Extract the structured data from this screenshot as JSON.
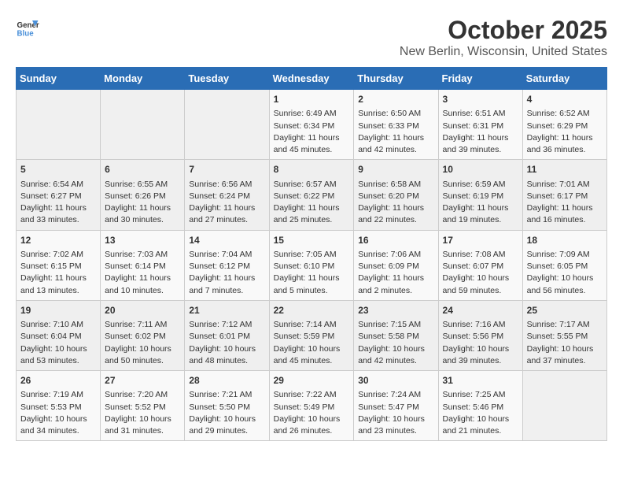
{
  "logo": {
    "line1": "General",
    "line2": "Blue"
  },
  "title": "October 2025",
  "location": "New Berlin, Wisconsin, United States",
  "days_of_week": [
    "Sunday",
    "Monday",
    "Tuesday",
    "Wednesday",
    "Thursday",
    "Friday",
    "Saturday"
  ],
  "weeks": [
    [
      {
        "day": "",
        "info": ""
      },
      {
        "day": "",
        "info": ""
      },
      {
        "day": "",
        "info": ""
      },
      {
        "day": "1",
        "info": "Sunrise: 6:49 AM\nSunset: 6:34 PM\nDaylight: 11 hours\nand 45 minutes."
      },
      {
        "day": "2",
        "info": "Sunrise: 6:50 AM\nSunset: 6:33 PM\nDaylight: 11 hours\nand 42 minutes."
      },
      {
        "day": "3",
        "info": "Sunrise: 6:51 AM\nSunset: 6:31 PM\nDaylight: 11 hours\nand 39 minutes."
      },
      {
        "day": "4",
        "info": "Sunrise: 6:52 AM\nSunset: 6:29 PM\nDaylight: 11 hours\nand 36 minutes."
      }
    ],
    [
      {
        "day": "5",
        "info": "Sunrise: 6:54 AM\nSunset: 6:27 PM\nDaylight: 11 hours\nand 33 minutes."
      },
      {
        "day": "6",
        "info": "Sunrise: 6:55 AM\nSunset: 6:26 PM\nDaylight: 11 hours\nand 30 minutes."
      },
      {
        "day": "7",
        "info": "Sunrise: 6:56 AM\nSunset: 6:24 PM\nDaylight: 11 hours\nand 27 minutes."
      },
      {
        "day": "8",
        "info": "Sunrise: 6:57 AM\nSunset: 6:22 PM\nDaylight: 11 hours\nand 25 minutes."
      },
      {
        "day": "9",
        "info": "Sunrise: 6:58 AM\nSunset: 6:20 PM\nDaylight: 11 hours\nand 22 minutes."
      },
      {
        "day": "10",
        "info": "Sunrise: 6:59 AM\nSunset: 6:19 PM\nDaylight: 11 hours\nand 19 minutes."
      },
      {
        "day": "11",
        "info": "Sunrise: 7:01 AM\nSunset: 6:17 PM\nDaylight: 11 hours\nand 16 minutes."
      }
    ],
    [
      {
        "day": "12",
        "info": "Sunrise: 7:02 AM\nSunset: 6:15 PM\nDaylight: 11 hours\nand 13 minutes."
      },
      {
        "day": "13",
        "info": "Sunrise: 7:03 AM\nSunset: 6:14 PM\nDaylight: 11 hours\nand 10 minutes."
      },
      {
        "day": "14",
        "info": "Sunrise: 7:04 AM\nSunset: 6:12 PM\nDaylight: 11 hours\nand 7 minutes."
      },
      {
        "day": "15",
        "info": "Sunrise: 7:05 AM\nSunset: 6:10 PM\nDaylight: 11 hours\nand 5 minutes."
      },
      {
        "day": "16",
        "info": "Sunrise: 7:06 AM\nSunset: 6:09 PM\nDaylight: 11 hours\nand 2 minutes."
      },
      {
        "day": "17",
        "info": "Sunrise: 7:08 AM\nSunset: 6:07 PM\nDaylight: 10 hours\nand 59 minutes."
      },
      {
        "day": "18",
        "info": "Sunrise: 7:09 AM\nSunset: 6:05 PM\nDaylight: 10 hours\nand 56 minutes."
      }
    ],
    [
      {
        "day": "19",
        "info": "Sunrise: 7:10 AM\nSunset: 6:04 PM\nDaylight: 10 hours\nand 53 minutes."
      },
      {
        "day": "20",
        "info": "Sunrise: 7:11 AM\nSunset: 6:02 PM\nDaylight: 10 hours\nand 50 minutes."
      },
      {
        "day": "21",
        "info": "Sunrise: 7:12 AM\nSunset: 6:01 PM\nDaylight: 10 hours\nand 48 minutes."
      },
      {
        "day": "22",
        "info": "Sunrise: 7:14 AM\nSunset: 5:59 PM\nDaylight: 10 hours\nand 45 minutes."
      },
      {
        "day": "23",
        "info": "Sunrise: 7:15 AM\nSunset: 5:58 PM\nDaylight: 10 hours\nand 42 minutes."
      },
      {
        "day": "24",
        "info": "Sunrise: 7:16 AM\nSunset: 5:56 PM\nDaylight: 10 hours\nand 39 minutes."
      },
      {
        "day": "25",
        "info": "Sunrise: 7:17 AM\nSunset: 5:55 PM\nDaylight: 10 hours\nand 37 minutes."
      }
    ],
    [
      {
        "day": "26",
        "info": "Sunrise: 7:19 AM\nSunset: 5:53 PM\nDaylight: 10 hours\nand 34 minutes."
      },
      {
        "day": "27",
        "info": "Sunrise: 7:20 AM\nSunset: 5:52 PM\nDaylight: 10 hours\nand 31 minutes."
      },
      {
        "day": "28",
        "info": "Sunrise: 7:21 AM\nSunset: 5:50 PM\nDaylight: 10 hours\nand 29 minutes."
      },
      {
        "day": "29",
        "info": "Sunrise: 7:22 AM\nSunset: 5:49 PM\nDaylight: 10 hours\nand 26 minutes."
      },
      {
        "day": "30",
        "info": "Sunrise: 7:24 AM\nSunset: 5:47 PM\nDaylight: 10 hours\nand 23 minutes."
      },
      {
        "day": "31",
        "info": "Sunrise: 7:25 AM\nSunset: 5:46 PM\nDaylight: 10 hours\nand 21 minutes."
      },
      {
        "day": "",
        "info": ""
      }
    ]
  ]
}
